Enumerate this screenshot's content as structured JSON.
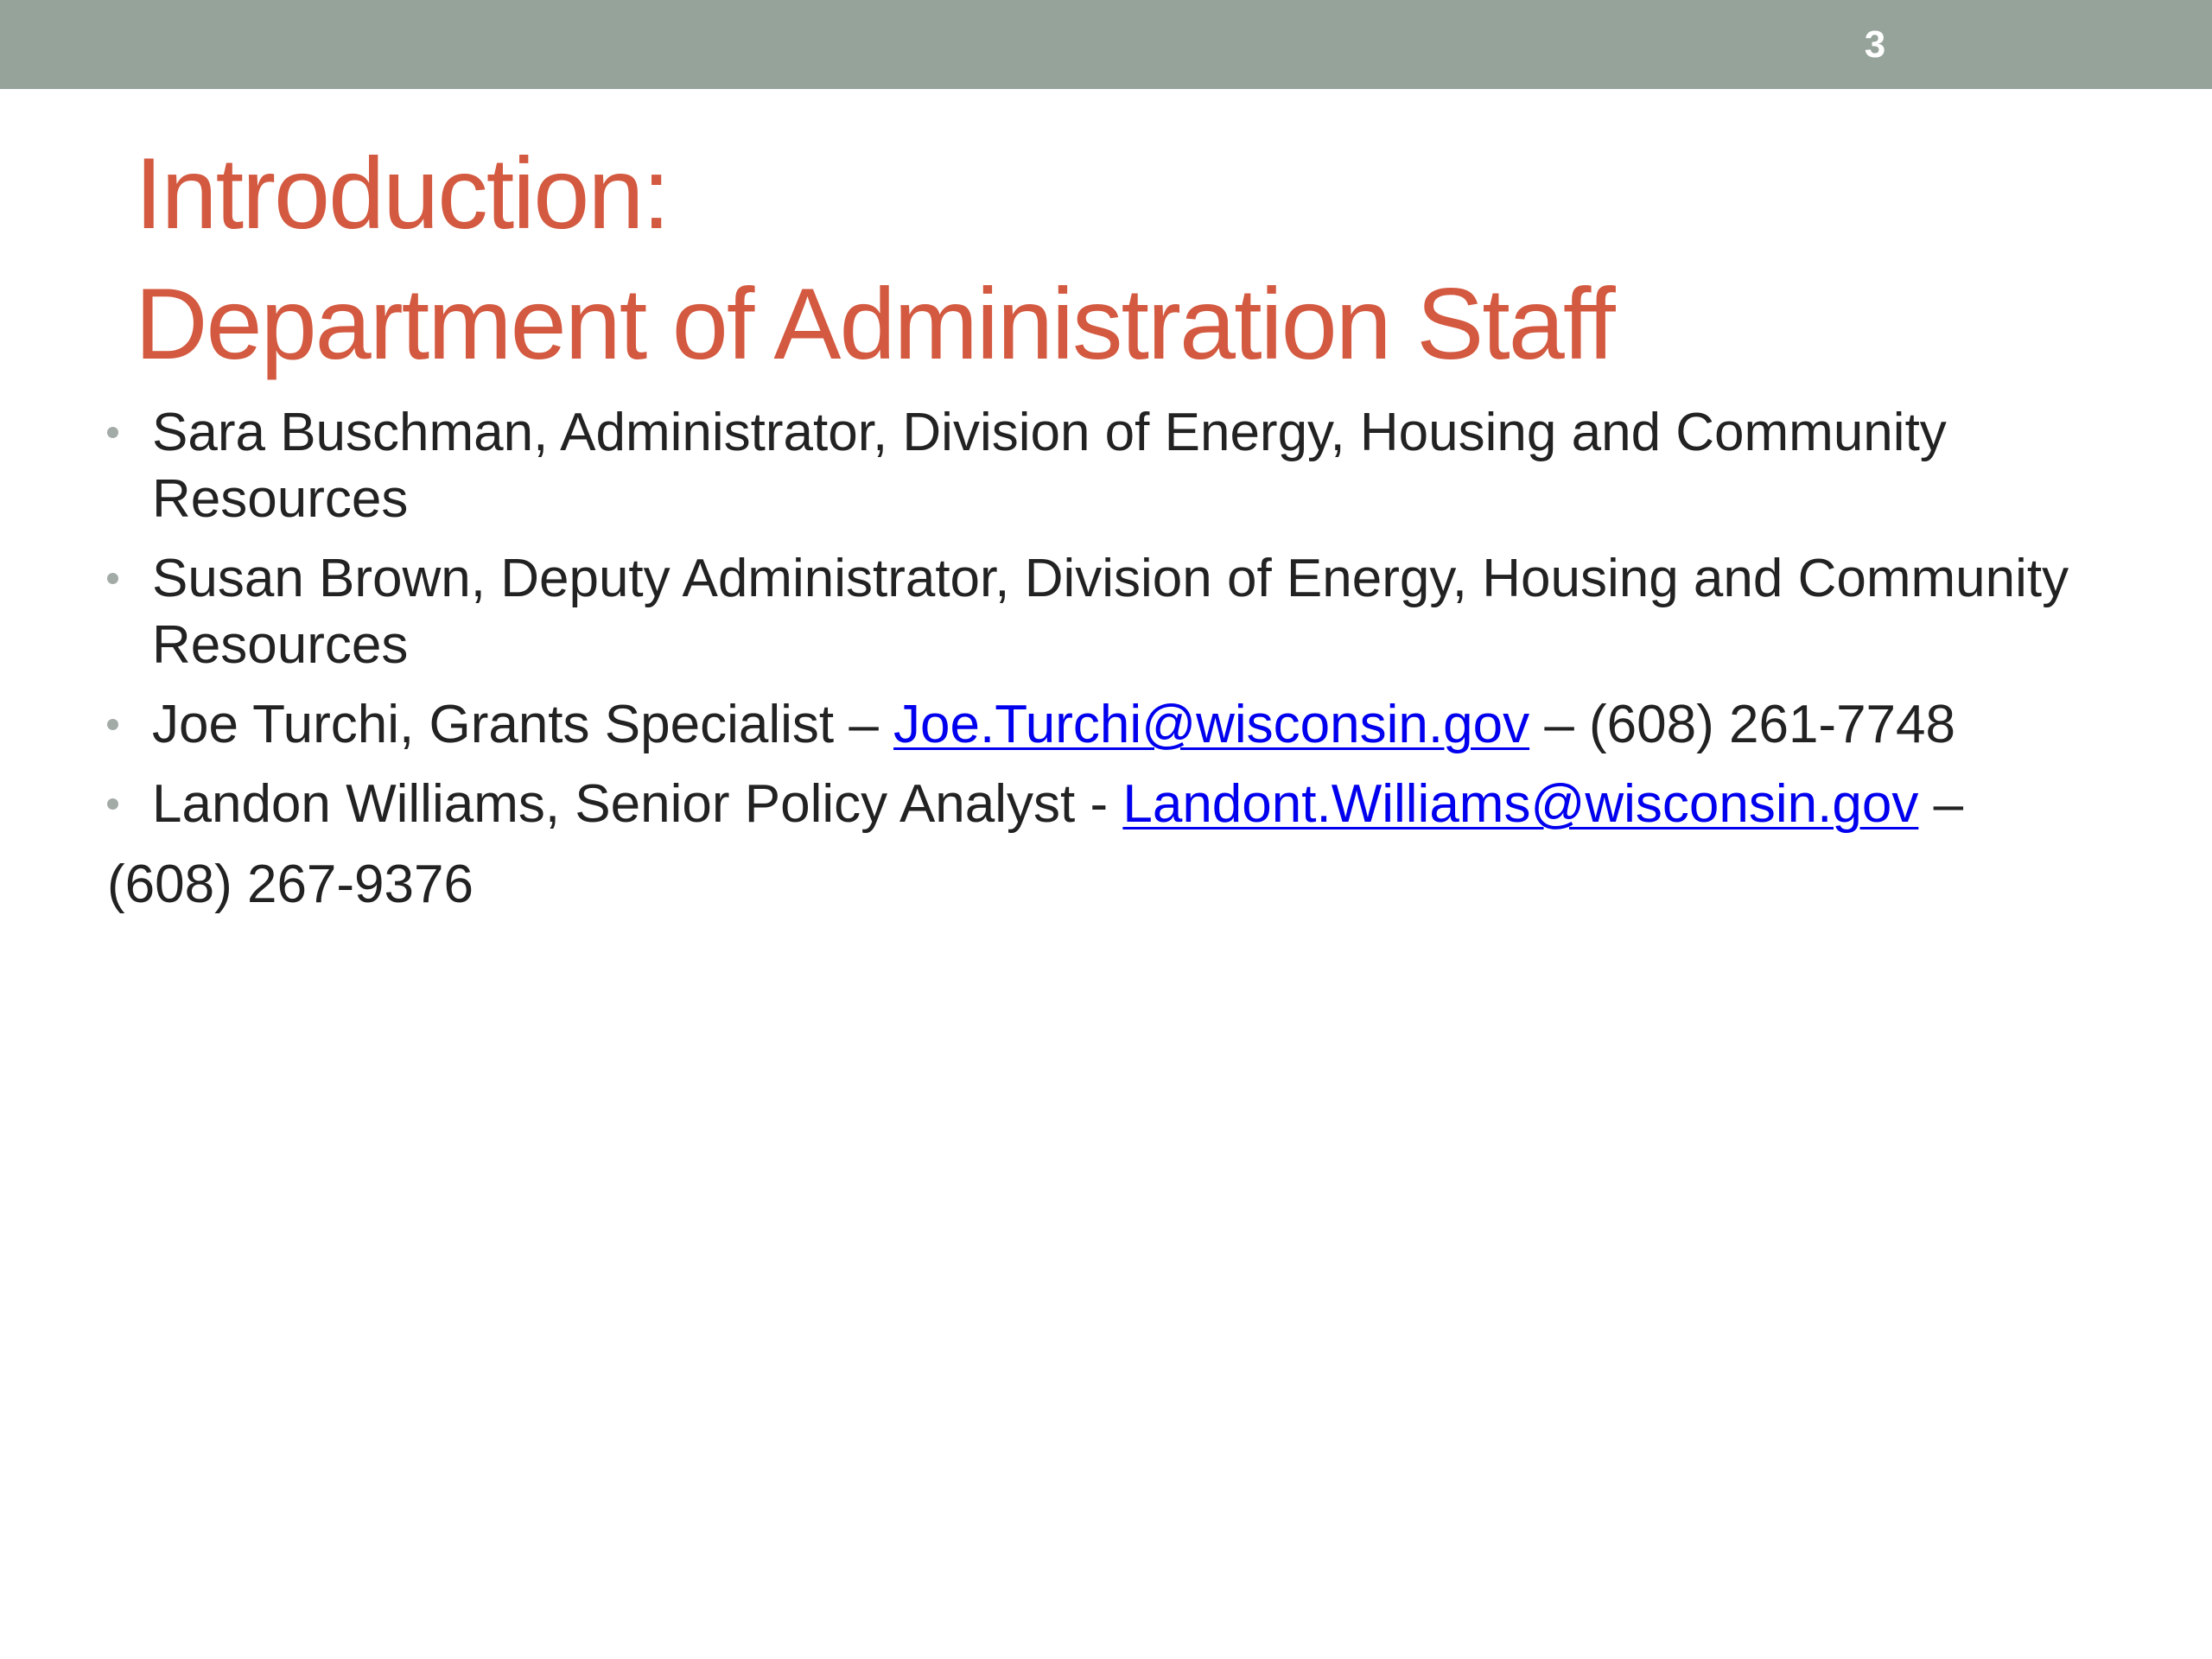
{
  "slide": {
    "number": "3",
    "title_line1": "Introduction:",
    "title_line2": "Department of Administration Staff"
  },
  "colors": {
    "top_bar": "#95a39b",
    "title": "#d35940",
    "body_text": "#222222",
    "link": "#0000ee",
    "bullet": "#a3aba6"
  },
  "staff": [
    {
      "line1": "Sara Buschman, Administrator, Division of Energy, Housing and Community",
      "line2": "Resources"
    },
    {
      "line1": "Susan Brown, Deputy Administrator, Division of Energy, Housing and Community",
      "line2": "Resources"
    },
    {
      "prefix": "Joe Turchi, Grants Specialist – ",
      "email": "Joe.Turchi@wisconsin.gov",
      "suffix": " – (608) 261-7748"
    },
    {
      "prefix": "Landon Williams, Senior Policy Analyst - ",
      "email": "Landont.Williams@wisconsin.gov",
      "suffix": " –",
      "continuation": "(608) 267-9376"
    }
  ]
}
